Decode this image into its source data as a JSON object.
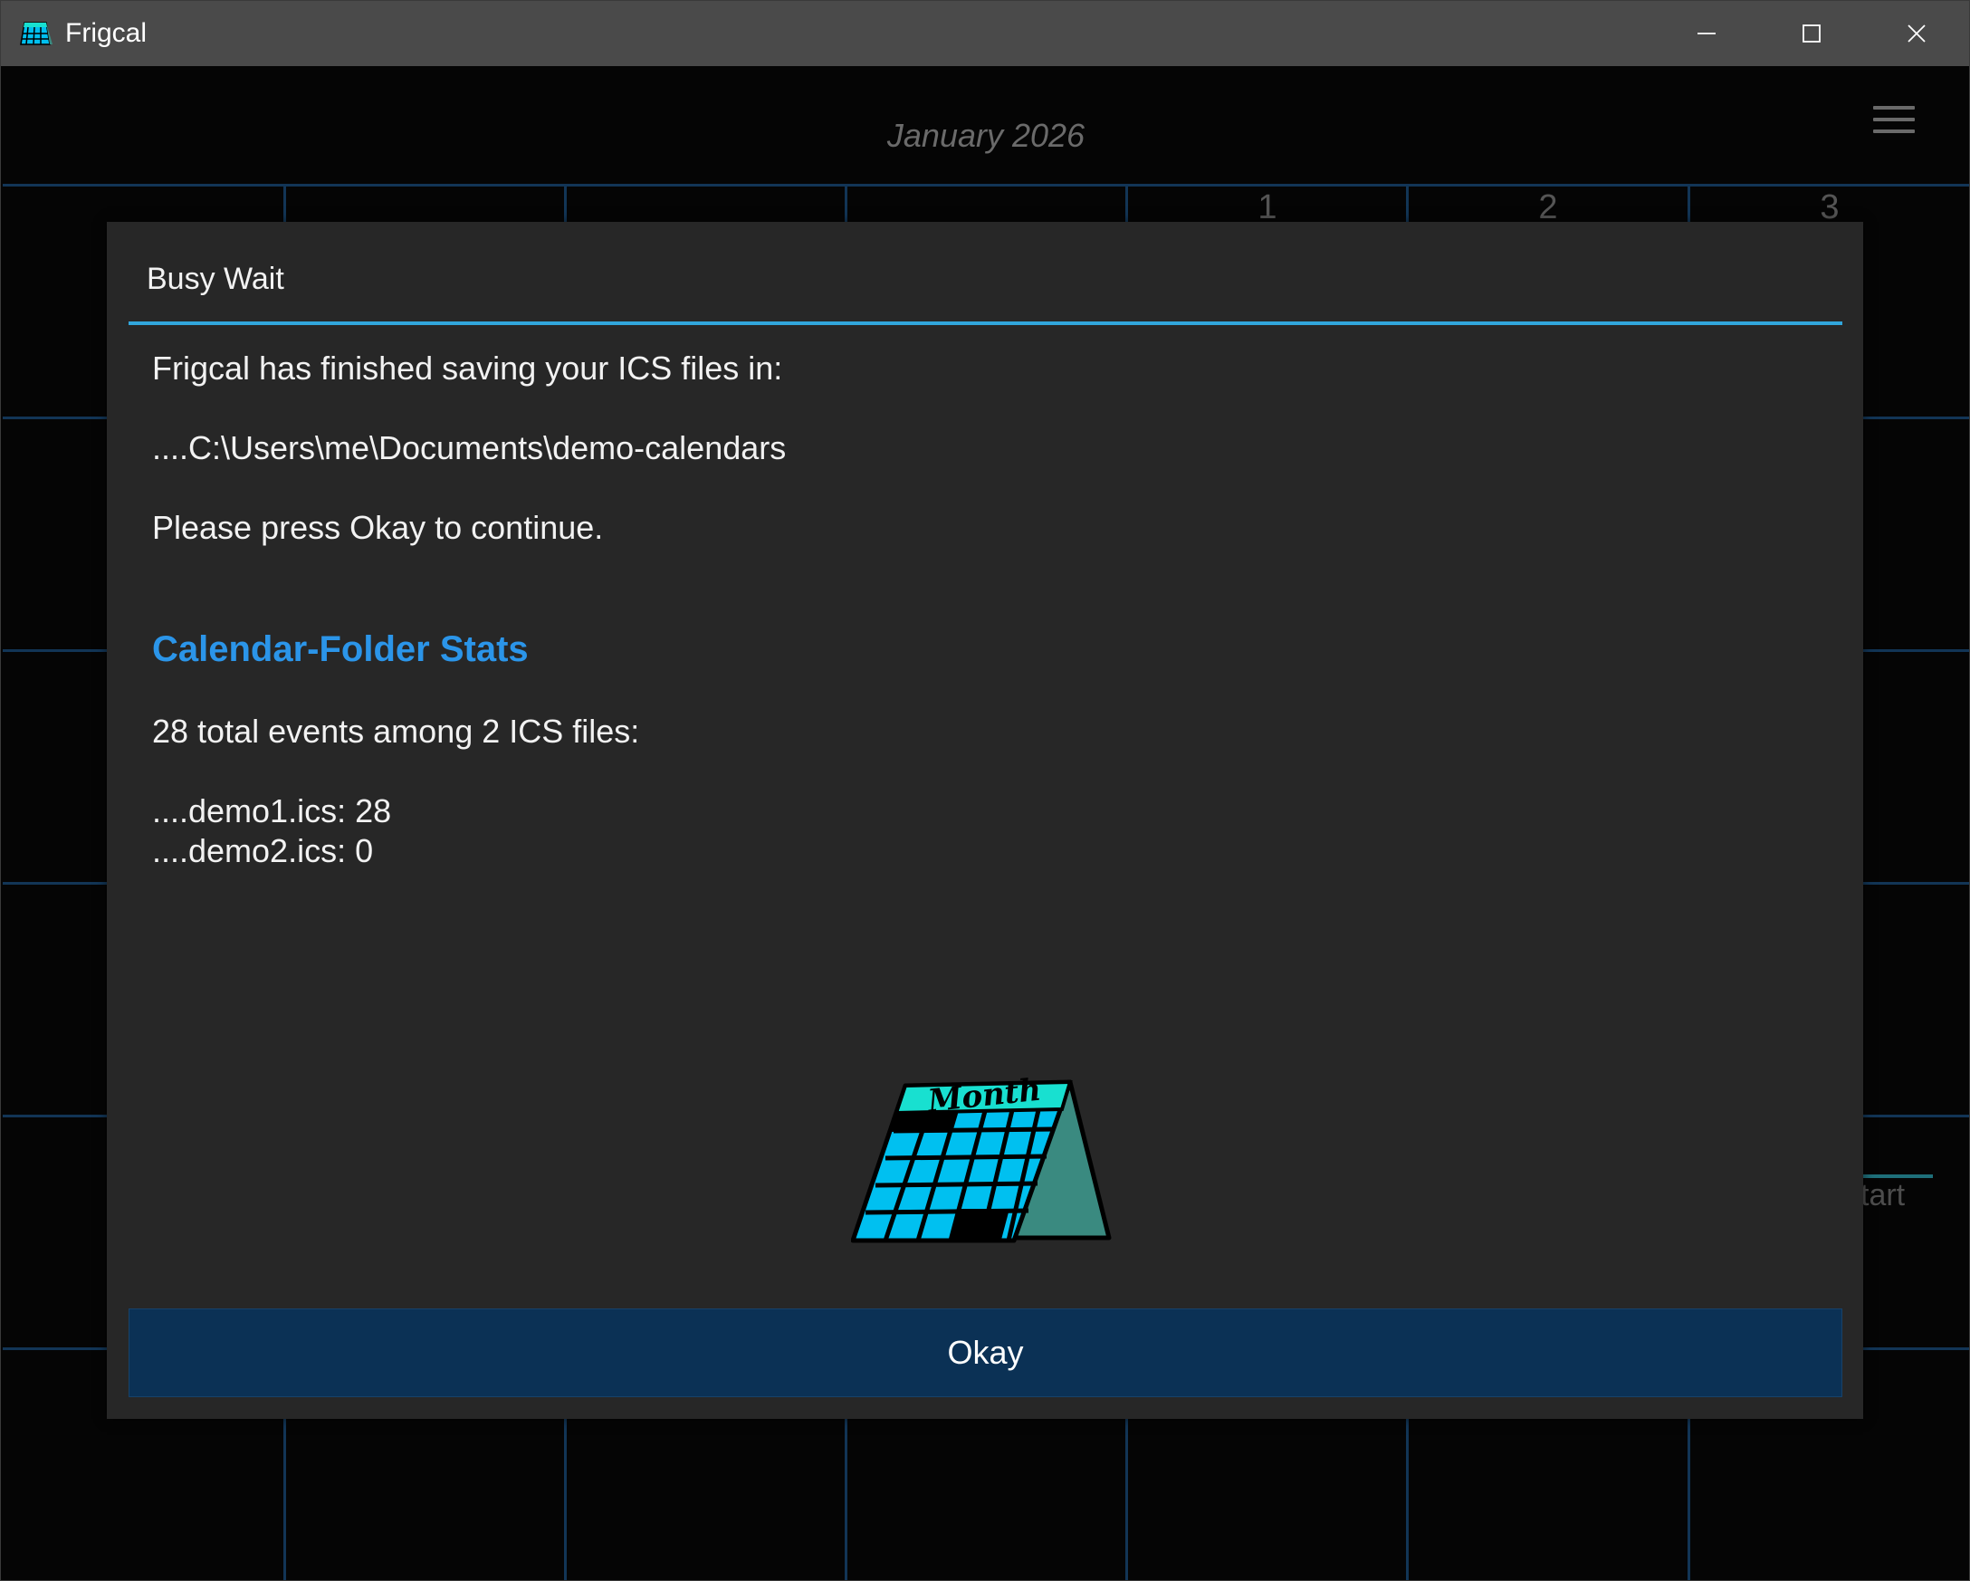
{
  "window": {
    "title": "Frigcal"
  },
  "calendar": {
    "month_title": "January 2026",
    "visible_day_numbers": [
      "1",
      "2",
      "3"
    ],
    "partial_background_text": "tart"
  },
  "dialog": {
    "title": "Busy Wait",
    "message_line1": "Frigcal has finished saving your ICS files in:",
    "folder_path": "....C:\\Users\\me\\Documents\\demo-calendars",
    "continue_prompt": "Please press Okay to continue.",
    "stats_title": "Calendar-Folder Stats",
    "stats_summary": "28 total events among 2 ICS files:",
    "file_stats": [
      "....demo1.ics: 28",
      "....demo2.ics: 0"
    ],
    "illustration_text": "Month",
    "okay_label": "Okay"
  },
  "colors": {
    "titlebar": "#4a4a4a",
    "dialog_bg": "#272727",
    "accent_rule": "#31a6dc",
    "stats_title": "#2b95e9",
    "okay_button": "#0b3155",
    "grid_lines": "#123556",
    "calendar_cells": "#00c0f0",
    "calendar_header": "#18e0d0"
  }
}
